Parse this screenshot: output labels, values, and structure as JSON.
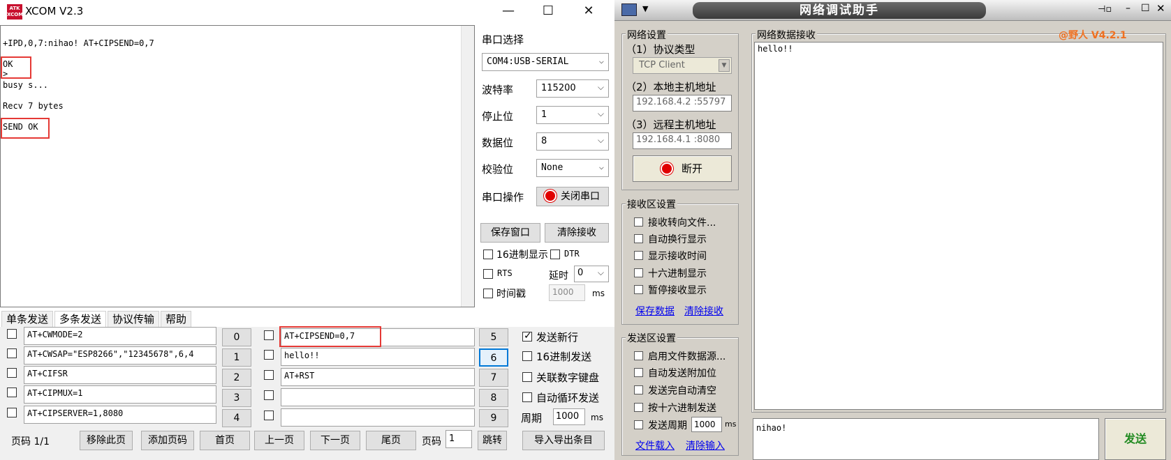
{
  "xcom": {
    "logo_text": "ATK XCOM",
    "title": "XCOM V2.3",
    "window_buttons": {
      "minimize": "—",
      "maximize": "☐",
      "close": "✕"
    },
    "receive_lines": [
      "+IPD,0,7:nihao! AT+CIPSEND=0,7",
      "OK",
      ">",
      "busy s...",
      "Recv 7 bytes",
      "SEND OK"
    ],
    "settings": {
      "port_label": "串口选择",
      "port_value": "COM4:USB-SERIAL",
      "baud_label": "波特率",
      "baud_value": "115200",
      "stopbits_label": "停止位",
      "stopbits_value": "1",
      "databits_label": "数据位",
      "databits_value": "8",
      "parity_label": "校验位",
      "parity_value": "None",
      "op_label": "串口操作",
      "close_port_btn": "关闭串口",
      "save_window_btn": "保存窗口",
      "clear_recv_btn": "清除接收",
      "hex_display": "16进制显示",
      "dtr": "DTR",
      "rts": "RTS",
      "delay_label": "延时",
      "delay_value": "0",
      "timestamp": "时间戳",
      "timestamp_value": "1000",
      "ms": "ms"
    },
    "tabs": [
      "单条发送",
      "多条发送",
      "协议传输",
      "帮助"
    ],
    "multi_left": [
      {
        "text": "AT+CWMODE=2",
        "num": "0"
      },
      {
        "text": "AT+CWSAP=\"ESP8266\",\"12345678\",6,4",
        "num": "1"
      },
      {
        "text": "AT+CIFSR",
        "num": "2"
      },
      {
        "text": "AT+CIPMUX=1",
        "num": "3"
      },
      {
        "text": "AT+CIPSERVER=1,8080",
        "num": "4"
      }
    ],
    "multi_right": [
      {
        "text": "AT+CIPSEND=0,7",
        "num": "5"
      },
      {
        "text": "hello!!",
        "num": "6"
      },
      {
        "text": "AT+RST",
        "num": "7"
      },
      {
        "text": "",
        "num": "8"
      },
      {
        "text": "",
        "num": "9"
      }
    ],
    "send_options": {
      "send_newline": "发送新行",
      "hex_send": "16进制发送",
      "link_keypad": "关联数字键盘",
      "auto_loop": "自动循环发送",
      "period_label": "周期",
      "period_value": "1000",
      "ms": "ms"
    },
    "bottom": {
      "page_code": "页码 1/1",
      "remove_page": "移除此页",
      "add_page": "添加页码",
      "first_page": "首页",
      "prev_page": "上一页",
      "next_page": "下一页",
      "last_page": "尾页",
      "page_label": "页码",
      "page_value": "1",
      "jump": "跳转",
      "import_export": "导入导出条目"
    }
  },
  "net": {
    "title": "网络调试助手",
    "version": "@野人 V4.2.1",
    "net_settings": {
      "label": "网络设置",
      "protocol_label": "（1）协议类型",
      "protocol_value": "TCP Client",
      "local_label": "（2）本地主机地址",
      "local_value": "192.168.4.2 :55797",
      "remote_label": "（3）远程主机地址",
      "remote_value": "192.168.4.1 :8080",
      "disconnect_btn": "断开"
    },
    "recv_settings": {
      "label": "接收区设置",
      "options": [
        "接收转向文件...",
        "自动换行显示",
        "显示接收时间",
        "十六进制显示",
        "暂停接收显示"
      ],
      "save_data": "保存数据",
      "clear_recv": "清除接收"
    },
    "send_settings": {
      "label": "发送区设置",
      "options": [
        "启用文件数据源...",
        "自动发送附加位",
        "发送完自动清空",
        "按十六进制发送"
      ],
      "period_label": "发送周期",
      "period_value": "1000",
      "ms": "ms",
      "load_file": "文件载入",
      "clear_input": "清除输入"
    },
    "recv_area_label": "网络数据接收",
    "recv_text": "hello!!",
    "send_text": "nihao!",
    "send_btn": "发送",
    "colors": {
      "version": "#f07020",
      "send_btn_text": "#228b22",
      "red_led": "#e00000"
    }
  }
}
